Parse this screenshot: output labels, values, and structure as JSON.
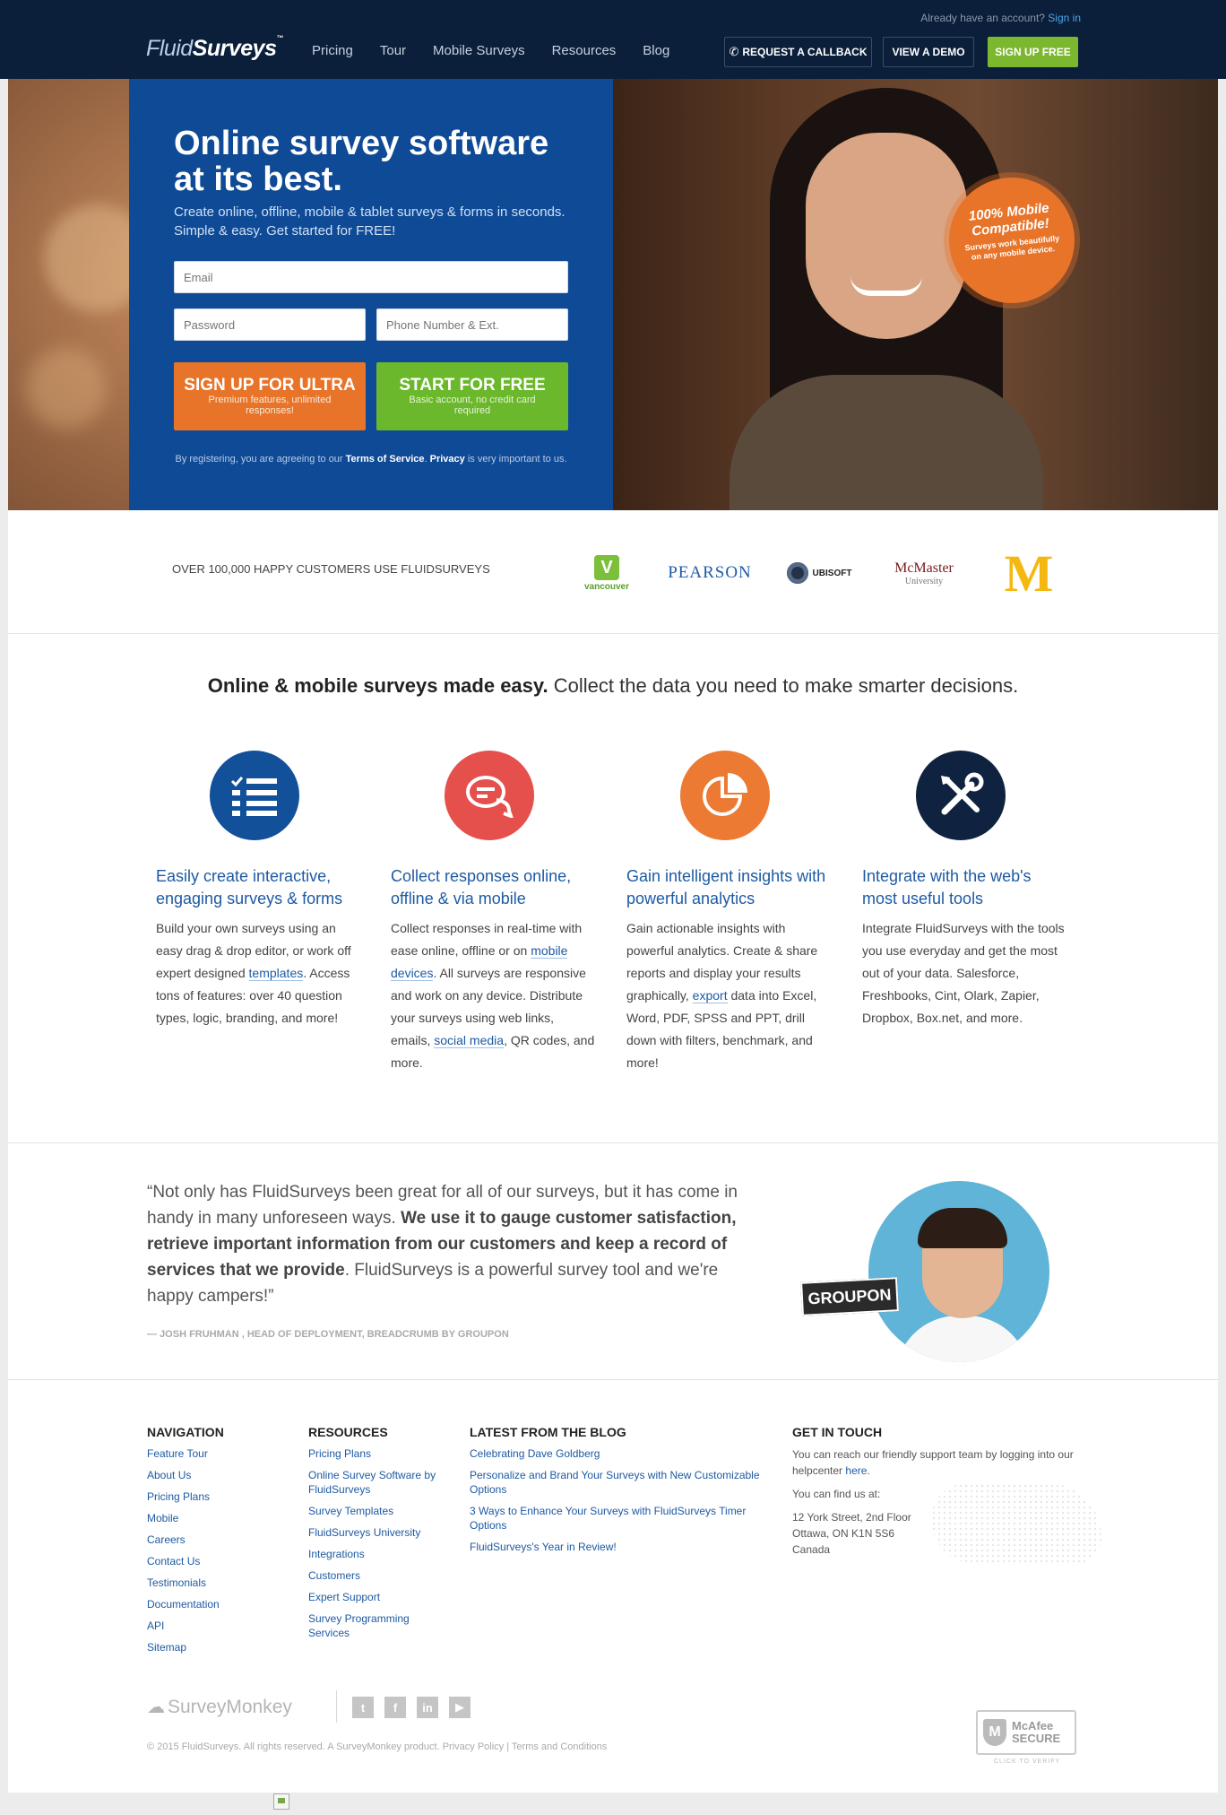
{
  "header": {
    "account_prompt": "Already have an account?",
    "sign_in": "Sign in",
    "logo_fluid": "Fluid",
    "logo_surveys": "Surveys",
    "logo_tm": "™",
    "nav": [
      "Pricing",
      "Tour",
      "Mobile Surveys",
      "Resources",
      "Blog"
    ],
    "callback_label": "REQUEST A CALLBACK",
    "demo_label": "VIEW A DEMO",
    "signup_label": "SIGN UP FREE"
  },
  "hero": {
    "title": "Online survey software at its best.",
    "lead": "Create online, offline, mobile & tablet surveys & forms in seconds. Simple & easy. Get started for FREE!",
    "email_placeholder": "Email",
    "password_placeholder": "Password",
    "phone_placeholder": "Phone Number & Ext.",
    "ultra_title": "SIGN UP FOR ULTRA",
    "ultra_sub": "Premium features, unlimited responses!",
    "free_title": "START FOR FREE",
    "free_sub": "Basic account, no credit card required",
    "legal_prefix": "By registering, you are agreeing to our",
    "terms": "Terms of Service",
    "privacy": "Privacy",
    "legal_suffix": "is very important to us.",
    "badge_title": "100% Mobile Compatible!",
    "badge_sub": "Surveys work beautifully on any mobile device."
  },
  "customers": {
    "claim": "OVER 100,000 HAPPY CUSTOMERS USE FLUIDSURVEYS",
    "tourism_v": "V",
    "tourism_text": "vancouver",
    "pearson": "PEARSON",
    "ubisoft": "UBISOFT",
    "mcmaster_name": "McMaster",
    "mcmaster_sub": "University",
    "mcdonalds": "M"
  },
  "features": {
    "headline_bold": "Online & mobile surveys made easy.",
    "headline_rest": "Collect the data you need to make smarter decisions.",
    "items": [
      {
        "title": "Easily create interactive, engaging surveys & forms",
        "text_1": "Build your own surveys using an easy drag & drop editor, or work off expert designed",
        "link_1": "templates",
        "text_2": ". Access tons of features: over 40 question types, logic, branding, and more!"
      },
      {
        "title": "Collect responses online, offline & via mobile",
        "text_1": "Collect responses in real-time with ease online, offline or on",
        "link_1": "mobile devices",
        "text_2": ". All surveys are responsive and work on any device. Distribute your surveys using web links, emails,",
        "link_2": "social media",
        "text_3": ", QR codes, and more."
      },
      {
        "title": "Gain intelligent insights with powerful analytics",
        "text_1": "Gain actionable insights with powerful analytics. Create & share reports and display your results graphically,",
        "link_1": "export",
        "text_2": "data into Excel, Word, PDF, SPSS and PPT, drill down with filters, benchmark, and more!"
      },
      {
        "title": "Integrate with the web's most useful tools",
        "text_1": "Integrate FluidSurveys with the tools you use everyday and get the most out of your data. Salesforce, Freshbooks, Cint, Olark, Zapier, Dropbox, Box.net, and more."
      }
    ]
  },
  "testimonial": {
    "quote_1": "“Not only has FluidSurveys been great for all of our surveys, but it has come in handy in many unforeseen ways.",
    "quote_bold": "We use it to gauge customer satisfaction, retrieve important information from our customers and keep a record of services that we provide",
    "quote_2": ". FluidSurveys is a powerful survey tool and we're happy campers!”",
    "cite": "— JOSH FRUHMAN , HEAD OF DEPLOYMENT, BREADCRUMB BY GROUPON",
    "company": "GROUPON"
  },
  "footer": {
    "navigation_title": "NAVIGATION",
    "navigation": [
      "Feature Tour",
      "About Us",
      "Pricing Plans",
      "Mobile",
      "Careers",
      "Contact Us",
      "Testimonials",
      "Documentation",
      "API",
      "Sitemap"
    ],
    "resources_title": "RESOURCES",
    "resources": [
      "Pricing Plans",
      "Online Survey Software by FluidSurveys",
      "Survey Templates",
      "FluidSurveys University",
      "Integrations",
      "Customers",
      "Expert Support",
      "Survey Programming Services"
    ],
    "blog_title": "LATEST FROM THE BLOG",
    "blog": [
      "Celebrating Dave Goldberg",
      "Personalize and Brand Your Surveys with New Customizable Options",
      "3 Ways to Enhance Your Surveys with FluidSurveys Timer Options",
      "FluidSurveys's Year in Review!"
    ],
    "contact_title": "GET IN TOUCH",
    "contact_text": "You can reach our friendly support team by logging into our helpcenter",
    "contact_link": "here",
    "find_us": "You can find us at:",
    "address_1": "12 York Street, 2nd Floor",
    "address_2": "Ottawa, ON K1N 5S6",
    "address_3": "Canada",
    "surveymonkey": "SurveyMonkey",
    "socials": [
      "t",
      "f",
      "in",
      "▶"
    ],
    "copyright": "© 2015 FluidSurveys. All rights reserved. A SurveyMonkey product. Privacy Policy | Terms and Conditions",
    "mcafee_1": "McAfee",
    "mcafee_2": "SECURE",
    "mcafee_verify": "CLICK TO VERIFY"
  },
  "icons": [
    "phone-icon",
    "checklist-icon",
    "chat-bubbles-icon",
    "pie-chart-icon",
    "tools-icon",
    "twitter-icon",
    "facebook-icon",
    "linkedin-icon",
    "youtube-icon",
    "broken-image-icon"
  ]
}
